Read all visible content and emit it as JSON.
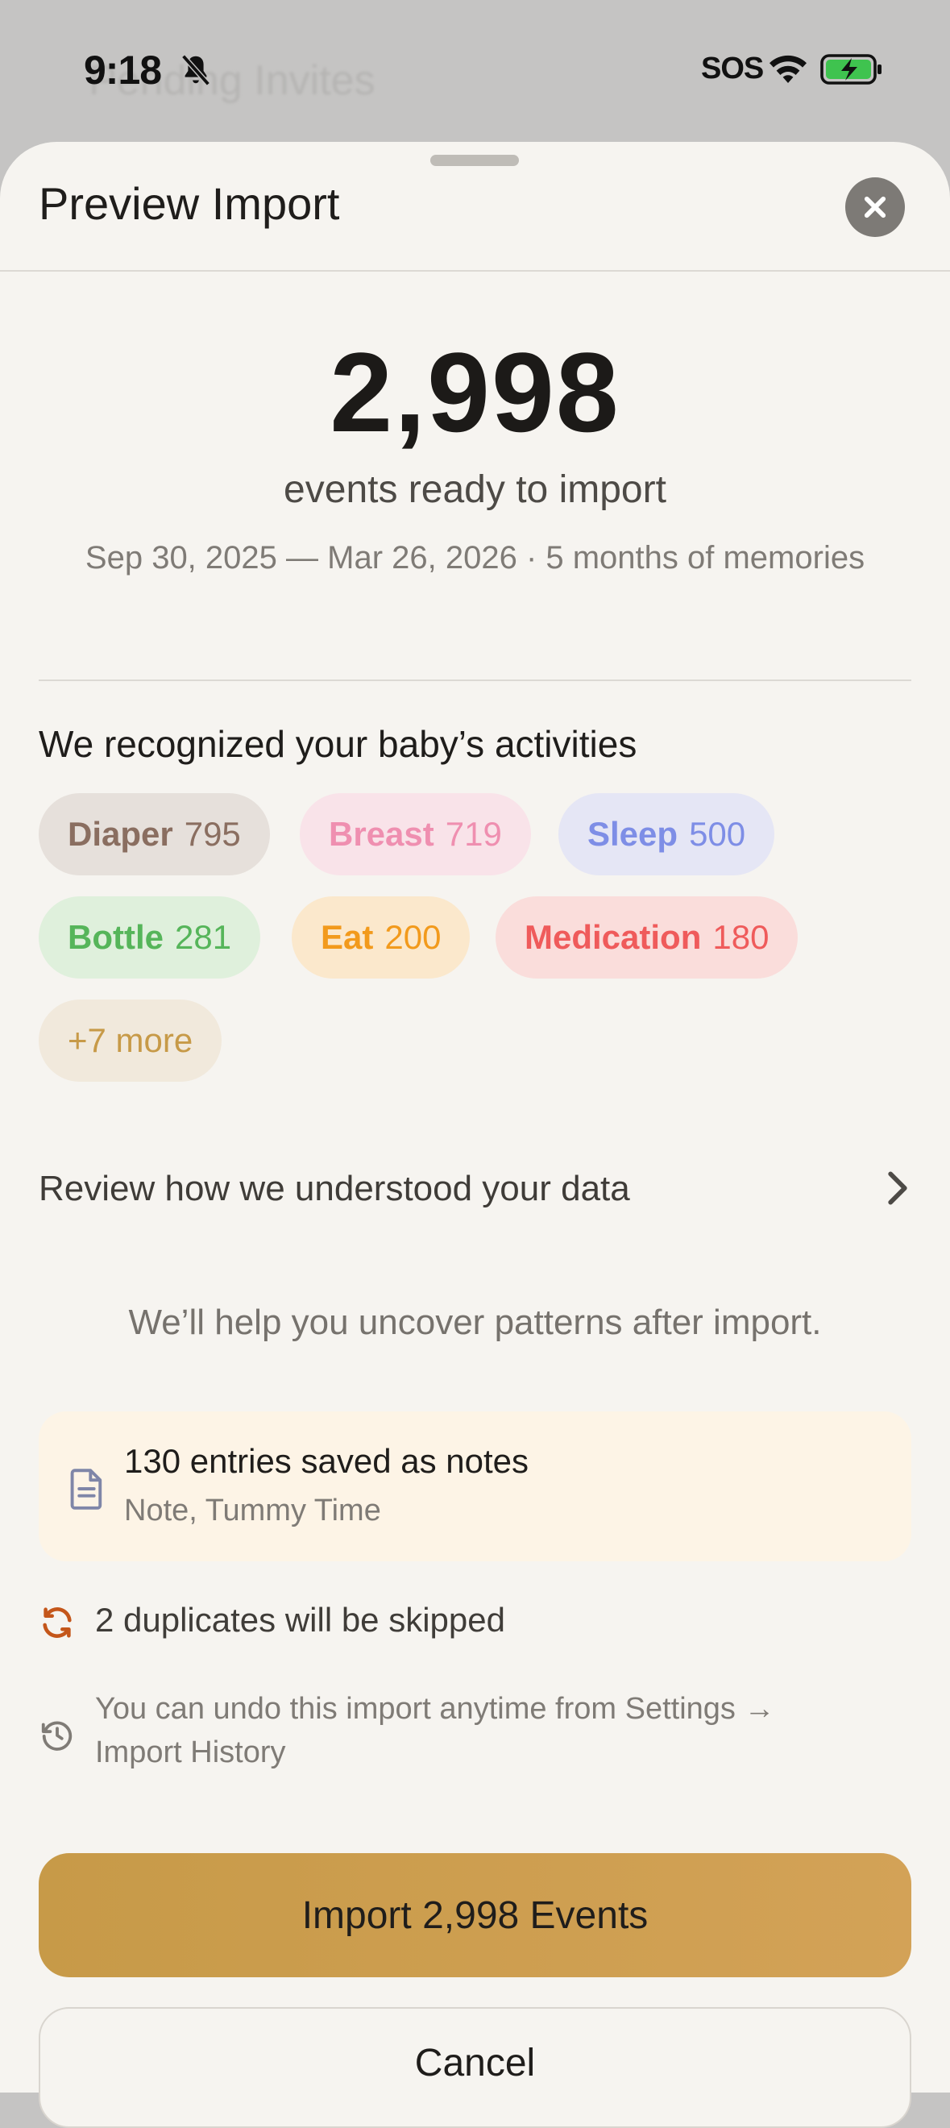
{
  "status_bar": {
    "time": "9:18",
    "sos": "SOS",
    "behind_title": "Pending Invites"
  },
  "sheet": {
    "title": "Preview Import"
  },
  "summary": {
    "count": "2,998",
    "subtitle": "events ready to import",
    "date_range": "Sep 30, 2025 — Mar 26, 2026 · 5 months of memories"
  },
  "activities": {
    "heading": "We recognized your baby’s activities",
    "chips": [
      {
        "label": "Diaper",
        "count": "795",
        "color": "#8a6e60",
        "bg": "#e6e0db"
      },
      {
        "label": "Breast",
        "count": "719",
        "color": "#ef8fb0",
        "bg": "#f9e3e9"
      },
      {
        "label": "Sleep",
        "count": "500",
        "color": "#7e8ee6",
        "bg": "#e5e6f5"
      },
      {
        "label": "Bottle",
        "count": "281",
        "color": "#56b55a",
        "bg": "#dff0dc"
      },
      {
        "label": "Eat",
        "count": "200",
        "color": "#f29a1c",
        "bg": "#fbe8cc"
      },
      {
        "label": "Medication",
        "count": "180",
        "color": "#ef5b5b",
        "bg": "#fadddb"
      }
    ],
    "more": {
      "label": "+7 more",
      "color": "#c79a48",
      "bg": "#f1e9dc"
    }
  },
  "review": {
    "label": "Review how we understood your data"
  },
  "help_text": "We’ll help you uncover patterns after import.",
  "notes": {
    "title": "130 entries saved as notes",
    "subtitle": "Note, Tummy Time"
  },
  "duplicates": {
    "text": "2 duplicates will be skipped"
  },
  "undo": {
    "text": "You can undo this import anytime from Settings → Import History"
  },
  "actions": {
    "import_label": "Import 2,998 Events",
    "cancel_label": "Cancel"
  }
}
